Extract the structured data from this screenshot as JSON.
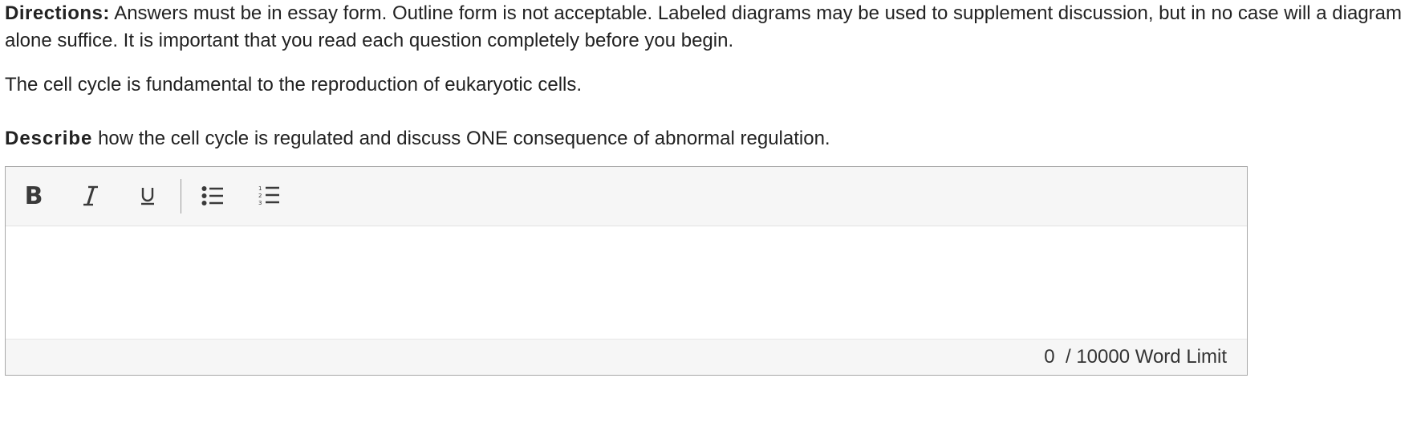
{
  "directions": {
    "label": "Directions:",
    "text": "Answers must be in essay form. Outline form is not acceptable. Labeled diagrams may be used to supplement discussion, but in no case will a diagram alone suffice. It is important that you read each question completely before you begin."
  },
  "stem": "The cell cycle is fundamental to the reproduction of eukaryotic cells.",
  "prompt": {
    "verb": "Describe",
    "text": "how the cell cycle is regulated and discuss ONE consequence of abnormal regulation."
  },
  "editor": {
    "toolbar": {
      "bold_label": "B",
      "tools": [
        "bold-icon",
        "italic-icon",
        "underline-icon",
        "bulleted-list-icon",
        "numbered-list-icon"
      ]
    },
    "content_value": "",
    "word_count": "0",
    "word_limit": "/ 10000 Word Limit"
  }
}
